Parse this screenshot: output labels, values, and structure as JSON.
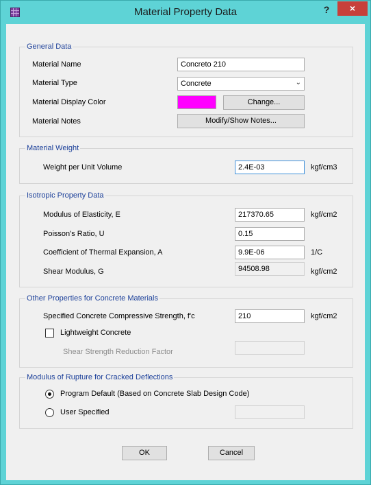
{
  "window": {
    "title": "Material Property Data",
    "help": "?",
    "close": "×"
  },
  "general": {
    "legend": "General Data",
    "material_name_label": "Material Name",
    "material_name_value": "Concreto 210",
    "material_type_label": "Material Type",
    "material_type_value": "Concrete",
    "display_color_label": "Material Display Color",
    "display_color": "#ff00ff",
    "change_button": "Change...",
    "notes_label": "Material Notes",
    "notes_button": "Modify/Show Notes..."
  },
  "weight": {
    "legend": "Material Weight",
    "label": "Weight per Unit Volume",
    "value": "2.4E-03",
    "unit": "kgf/cm3"
  },
  "isotropic": {
    "legend": "Isotropic Property Data",
    "modulus_label": "Modulus of Elasticity,  E",
    "modulus_value": "217370.65",
    "modulus_unit": "kgf/cm2",
    "poisson_label": "Poisson's Ratio,  U",
    "poisson_value": "0.15",
    "thermal_label": "Coefficient of Thermal Expansion,  A",
    "thermal_value": "9.9E-06",
    "thermal_unit": "1/C",
    "shear_label": "Shear Modulus,  G",
    "shear_value": "94508.98",
    "shear_unit": "kgf/cm2"
  },
  "concrete": {
    "legend": "Other Properties for Concrete Materials",
    "fc_label": "Specified Concrete Compressive Strength, f'c",
    "fc_value": "210",
    "fc_unit": "kgf/cm2",
    "lightweight_label": "Lightweight Concrete",
    "lightweight_checked": false,
    "reduction_label": "Shear Strength Reduction Factor",
    "reduction_value": ""
  },
  "rupture": {
    "legend": "Modulus of Rupture for Cracked Deflections",
    "default_label": "Program Default  (Based on Concrete Slab Design Code)",
    "default_selected": true,
    "user_label": "User Specified",
    "user_value": ""
  },
  "footer": {
    "ok": "OK",
    "cancel": "Cancel"
  }
}
